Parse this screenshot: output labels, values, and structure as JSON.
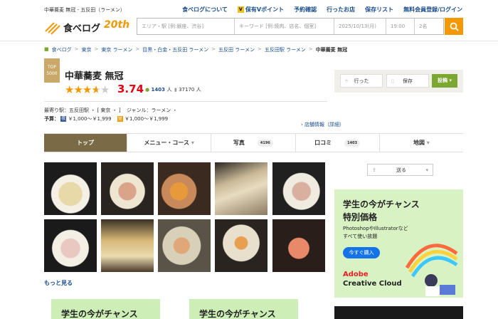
{
  "header": {
    "breadcrumb_top": "中華蕎麦 無冠 - 五反田（ラーメン）",
    "links": [
      "食べログについて",
      "保有Vポイント",
      "予約確認",
      "行ったお店",
      "保存リスト",
      "無料会員登録/ログイン"
    ],
    "logo_text": "食べログ",
    "logo_anniv": "20th",
    "search": {
      "area_placeholder": "エリア・駅 [例:銀座、渋谷]",
      "keyword_placeholder": "キーワード [例:焼肉、店名、個室]",
      "date": "2025/10/13(月)",
      "time": "19:00",
      "people": "2名"
    }
  },
  "breadcrumb": [
    "食べログ",
    "東京",
    "東京 ラーメン",
    "目黒・白金・五反田 ラーメン",
    "五反田 ラーメン",
    "五反田駅 ラーメン",
    "中華蕎麦 無冠"
  ],
  "restaurant": {
    "badge_top": "TOP",
    "badge_num": "5000",
    "name": "中華蕎麦 無冠",
    "rating": 3.74,
    "rating_text": "3.74",
    "reviews": "1403",
    "reviews_unit": "人",
    "saves": "37170",
    "saves_unit": "人",
    "station": "最寄り駅：五反田駅 ・ [ 東京 ・ ]",
    "genre": "ジャンル：ラーメン ・",
    "budget_label": "予算：",
    "budget_dinner": "￥1,000～￥1,999",
    "budget_lunch": "￥1,000～￥1,999",
    "detail_link": "店舗情報（詳細）"
  },
  "actions": {
    "went": "行った",
    "save": "保存",
    "post": "投稿"
  },
  "tabs": [
    {
      "label": "トップ",
      "count": ""
    },
    {
      "label": "メニュー・コース",
      "count": ""
    },
    {
      "label": "写真",
      "count": "4196"
    },
    {
      "label": "口コミ",
      "count": "1403"
    },
    {
      "label": "地図",
      "count": ""
    }
  ],
  "more_link": "もっと見る",
  "send_label": "送る",
  "ad": {
    "line1": "学生の今がチャンス",
    "line2": "特別価格",
    "line3": "PhotoshopやIllustratorなど",
    "line4": "すべて使い放題",
    "cta": "今すぐ購入",
    "brand1": "Adobe",
    "brand2": "Creative Cloud"
  },
  "ad_bottom_text": "学生の今がチャンス",
  "colors": {
    "accent": "#f39800",
    "link": "#1a4d8c",
    "score": "#e60012",
    "tab_active": "#7a6a45",
    "post": "#7ca832"
  }
}
